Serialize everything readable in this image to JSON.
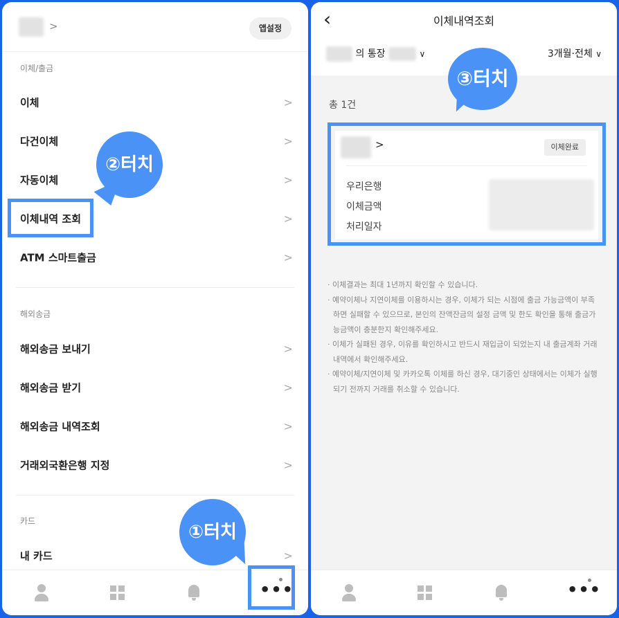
{
  "left": {
    "header": {
      "chevron": ">",
      "app_setting_label": "앱설정"
    },
    "sections": [
      {
        "label": "이체/출금",
        "items": [
          "이체",
          "다건이체",
          "자동이체",
          "이체내역 조회",
          "ATM 스마트출금"
        ]
      },
      {
        "label": "해외송금",
        "items": [
          "해외송금 보내기",
          "해외송금 받기",
          "해외송금 내역조회",
          "거래외국환은행 지정"
        ]
      },
      {
        "label": "카드",
        "items": [
          "내 카드"
        ]
      }
    ],
    "item_arrow": ">",
    "callouts": {
      "touch1": "①터치",
      "touch2": "②터치"
    },
    "bottom_nav": {
      "more_label": "•••"
    }
  },
  "right": {
    "title": "이체내역조회",
    "back_icon": "‹",
    "account_suffix": "의 통장",
    "period_filter": "3개월·전체",
    "dropdown_icon": "∨",
    "total_count": "총 1건",
    "card": {
      "chevron": ">",
      "status_badge": "이체완료",
      "rows": [
        "우리은행",
        "이체금액",
        "처리일자"
      ]
    },
    "notes": [
      "· 이체결과는 최대 1년까지 확인할 수 있습니다.",
      "· 예약이체나 지연이체를 이용하시는 경우, 이체가 되는 시점에 출금 가능금액이 부족하면 실패할 수 있으므로, 본인의 잔액잔금의 설정 금액 및 한도 확인을 통해 출금가능금액이 충분한지 확인해주세요.",
      "· 이체가 실패된 경우, 이유를 확인하시고 반드시 재입금이 되었는지 내 출금계좌 거래내역에서 확인해주세요.",
      "· 예약이체/지연이체 및 카카오톡 이체를 하신 경우, 대기중인 상태에서는 이체가 실행되기 전까지 거래를 취소할 수 있습니다."
    ],
    "callout": "③터치",
    "bottom_nav": {
      "more_label": "•••"
    }
  },
  "colors": {
    "accent_blue": "#4a92f5",
    "frame_blue": "#1a63e8"
  }
}
